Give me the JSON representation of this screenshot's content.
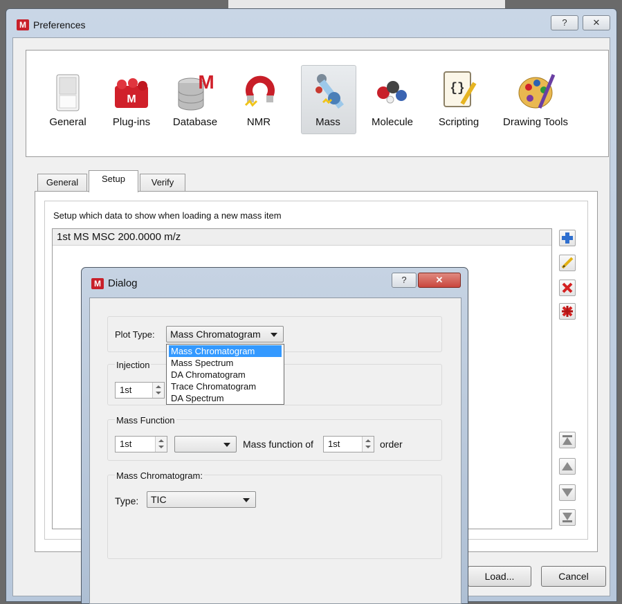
{
  "main_window": {
    "title": "Preferences",
    "app_icon_letter": "M",
    "help_button": "?",
    "close_button": "✕"
  },
  "categories": [
    {
      "label": "General",
      "icon": "general-switch-icon"
    },
    {
      "label": "Plug-ins",
      "icon": "plugins-icon"
    },
    {
      "label": "Database",
      "icon": "database-icon"
    },
    {
      "label": "NMR",
      "icon": "nmr-magnet-icon"
    },
    {
      "label": "Mass",
      "icon": "mass-spec-icon",
      "selected": true
    },
    {
      "label": "Molecule",
      "icon": "molecule-icon"
    },
    {
      "label": "Scripting",
      "icon": "scripting-scroll-icon"
    },
    {
      "label": "Drawing Tools",
      "icon": "palette-icon"
    }
  ],
  "tabs": [
    {
      "label": "General"
    },
    {
      "label": "Setup",
      "active": true
    },
    {
      "label": "Verify"
    }
  ],
  "setup": {
    "description": "Setup which data to show when loading a new mass item",
    "items": [
      "1st  MS MSC 200.0000 m/z"
    ],
    "side_buttons": [
      "add-icon",
      "edit-icon",
      "delete-icon",
      "delete-all-icon",
      "move-top-icon",
      "move-up-icon",
      "move-down-icon",
      "move-bottom-icon"
    ]
  },
  "bottom_buttons": {
    "load": "Load...",
    "cancel": "Cancel"
  },
  "dialog": {
    "title": "Dialog",
    "app_icon_letter": "M",
    "help_button": "?",
    "close_button": "✕",
    "plot_type": {
      "label": "Plot Type:",
      "value": "Mass Chromatogram",
      "options": [
        "Mass Chromatogram",
        "Mass Spectrum",
        "DA Chromatogram",
        "Trace Chromatogram",
        "DA Spectrum"
      ]
    },
    "injection": {
      "label": "Injection",
      "value": "1st"
    },
    "mass_function": {
      "label": "Mass Function",
      "value": "1st",
      "combo_value": "",
      "of_label": "Mass function of",
      "order_value": "1st",
      "order_label": "order"
    },
    "mass_chromatogram": {
      "label": "Mass Chromatogram:",
      "type_label": "Type:",
      "type_value": "TIC"
    }
  },
  "colors": {
    "accent_selection": "#3399ff",
    "app_icon": "#c8202a",
    "close_button": "#c9463d"
  }
}
